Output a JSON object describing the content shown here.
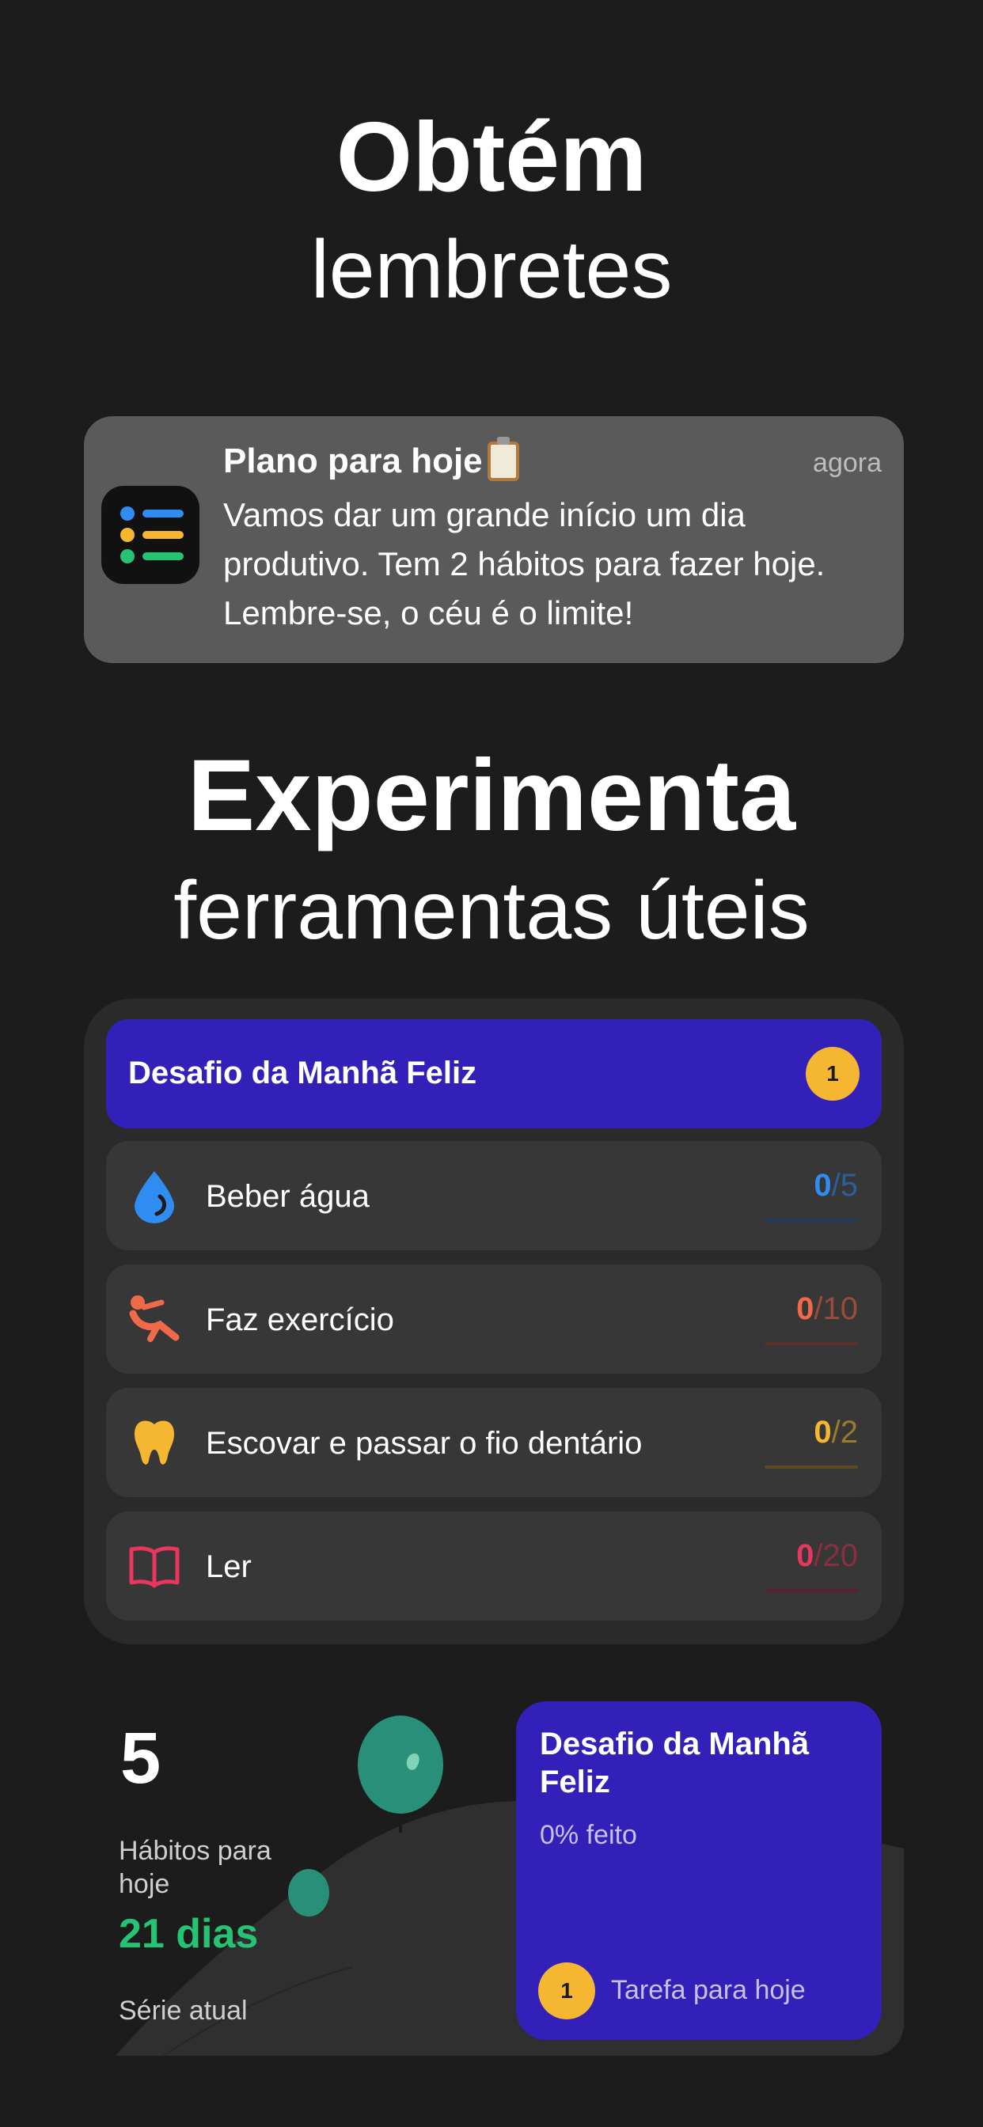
{
  "headline1": {
    "bold": "Obtém",
    "light": "lembretes"
  },
  "notification": {
    "title": "Plano para hoje",
    "time": "agora",
    "body": "Vamos dar um grande início um dia produtivo. Tem 2 hábitos para fazer hoje. Lembre-se, o céu é o limite!",
    "colors": {
      "blue": "#2f8cf0",
      "yellow": "#f5b731",
      "green": "#27c374"
    }
  },
  "headline2": {
    "bold": "Experimenta",
    "light": "ferramentas úteis"
  },
  "challenge": {
    "title": "Desafio da Manhã Feliz",
    "badge": "1",
    "color": "#3220b8"
  },
  "habits": [
    {
      "label": "Beber água",
      "done": "0",
      "total": "/5",
      "color": "#2f8cf0",
      "icon": "water-drop-icon"
    },
    {
      "label": "Faz exercício",
      "done": "0",
      "total": "/10",
      "color": "#f06a4a",
      "icon": "exercise-icon"
    },
    {
      "label": "Escovar e passar o fio dentário",
      "done": "0",
      "total": "/2",
      "color": "#f5b731",
      "icon": "tooth-icon"
    },
    {
      "label": "Ler",
      "done": "0",
      "total": "/20",
      "color": "#e8365d",
      "icon": "book-icon"
    }
  ],
  "stats": {
    "habits_count": "5",
    "habits_label": "Hábitos para hoje",
    "streak": "21 dias",
    "streak_label": "Série atual"
  },
  "challenge_card": {
    "title": "Desafio da Manhã Feliz",
    "progress": "0% feito",
    "badge": "1",
    "task": "Tarefa para hoje"
  }
}
